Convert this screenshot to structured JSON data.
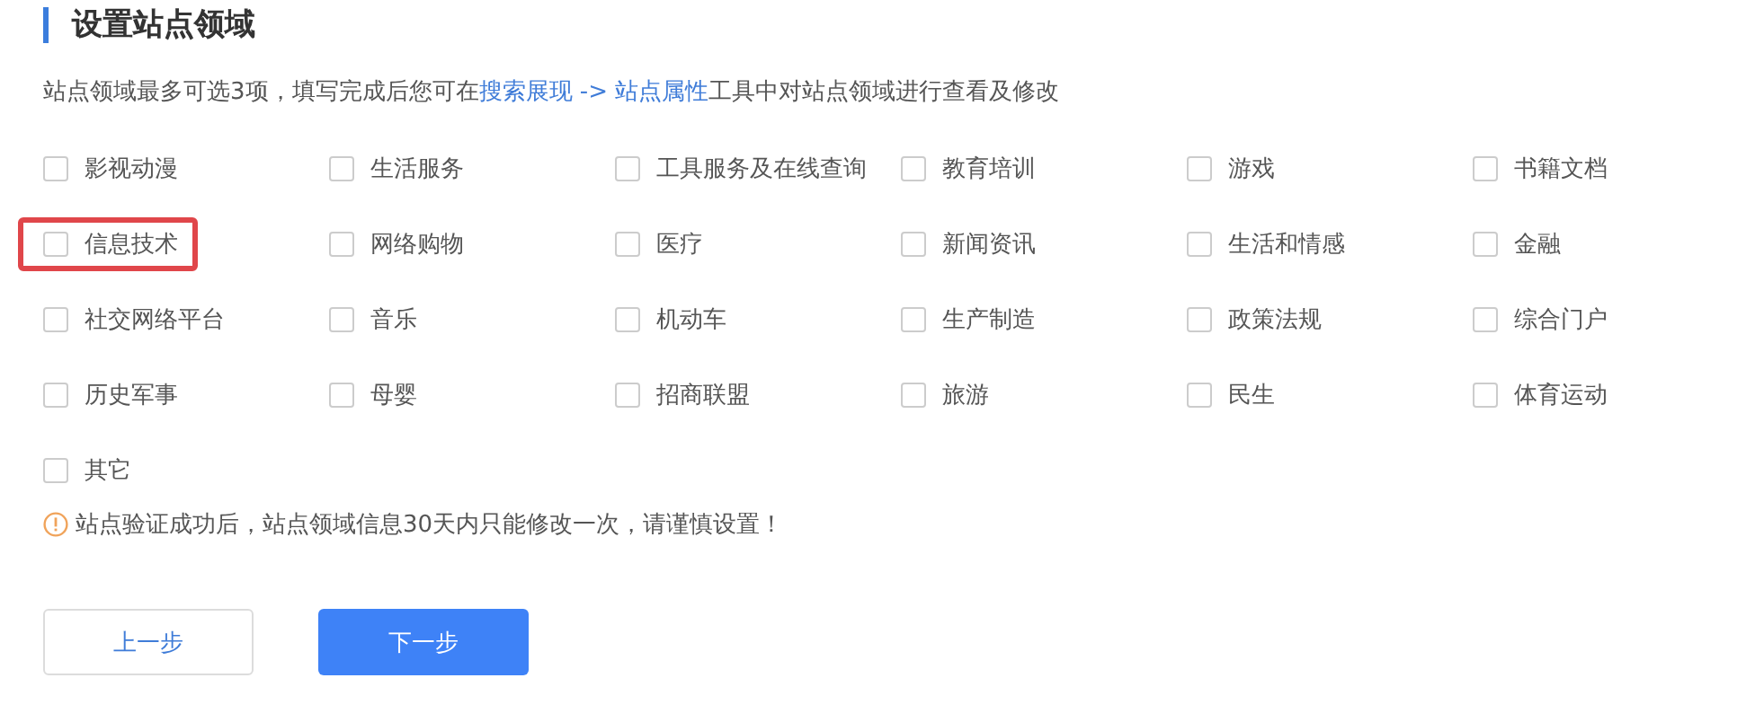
{
  "title": "设置站点领域",
  "description": [
    {
      "kind": "text",
      "text": "站点领域最多可选3项，填写完成后您可在"
    },
    {
      "kind": "link",
      "text": "搜索展现 -> 站点属性"
    },
    {
      "kind": "text",
      "text": "工具中对站点领域进行查看及修改"
    }
  ],
  "options": [
    {
      "label": "影视动漫",
      "checked": false,
      "highlighted": false
    },
    {
      "label": "生活服务",
      "checked": false,
      "highlighted": false
    },
    {
      "label": "工具服务及在线查询",
      "checked": false,
      "highlighted": false
    },
    {
      "label": "教育培训",
      "checked": false,
      "highlighted": false
    },
    {
      "label": "游戏",
      "checked": false,
      "highlighted": false
    },
    {
      "label": "书籍文档",
      "checked": false,
      "highlighted": false
    },
    {
      "label": "信息技术",
      "checked": false,
      "highlighted": true
    },
    {
      "label": "网络购物",
      "checked": false,
      "highlighted": false
    },
    {
      "label": "医疗",
      "checked": false,
      "highlighted": false
    },
    {
      "label": "新闻资讯",
      "checked": false,
      "highlighted": false
    },
    {
      "label": "生活和情感",
      "checked": false,
      "highlighted": false
    },
    {
      "label": "金融",
      "checked": false,
      "highlighted": false
    },
    {
      "label": "社交网络平台",
      "checked": false,
      "highlighted": false
    },
    {
      "label": "音乐",
      "checked": false,
      "highlighted": false
    },
    {
      "label": "机动车",
      "checked": false,
      "highlighted": false
    },
    {
      "label": "生产制造",
      "checked": false,
      "highlighted": false
    },
    {
      "label": "政策法规",
      "checked": false,
      "highlighted": false
    },
    {
      "label": "综合门户",
      "checked": false,
      "highlighted": false
    },
    {
      "label": "历史军事",
      "checked": false,
      "highlighted": false
    },
    {
      "label": "母婴",
      "checked": false,
      "highlighted": false
    },
    {
      "label": "招商联盟",
      "checked": false,
      "highlighted": false
    },
    {
      "label": "旅游",
      "checked": false,
      "highlighted": false
    },
    {
      "label": "民生",
      "checked": false,
      "highlighted": false
    },
    {
      "label": "体育运动",
      "checked": false,
      "highlighted": false
    },
    {
      "label": "其它",
      "checked": false,
      "highlighted": false
    }
  ],
  "notice": "站点验证成功后，站点领域信息30天内只能修改一次，请谨慎设置！",
  "buttons": [
    {
      "label": "上一步",
      "kind": "secondary"
    },
    {
      "label": "下一步",
      "kind": "primary"
    }
  ]
}
